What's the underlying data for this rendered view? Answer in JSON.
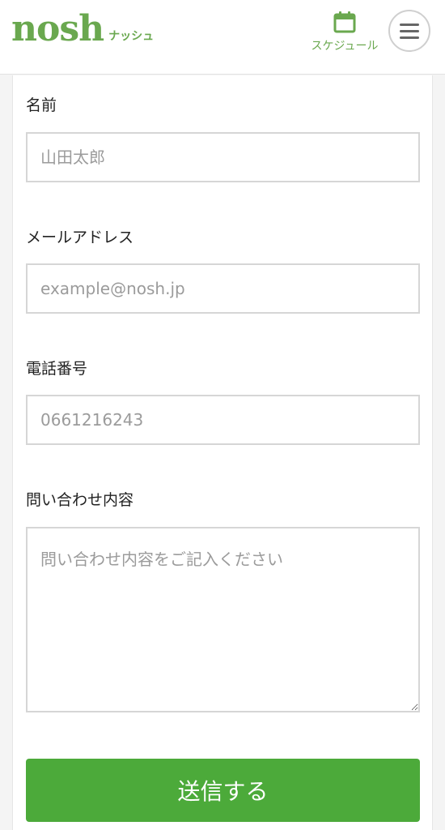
{
  "header": {
    "logo_text": "nosh",
    "logo_sub": "ナッシュ",
    "schedule_label": "スケジュール",
    "schedule_icon": "calendar-icon",
    "menu_icon": "hamburger-menu-icon"
  },
  "form": {
    "name": {
      "label": "名前",
      "placeholder": "山田太郎"
    },
    "email": {
      "label": "メールアドレス",
      "placeholder": "example@nosh.jp"
    },
    "phone": {
      "label": "電話番号",
      "placeholder": "0661216243"
    },
    "inquiry": {
      "label": "問い合わせ内容",
      "placeholder": "問い合わせ内容をご記入ください"
    },
    "submit_label": "送信する"
  },
  "colors": {
    "brand_green": "#6aa84f",
    "button_green": "#4caa3a"
  }
}
